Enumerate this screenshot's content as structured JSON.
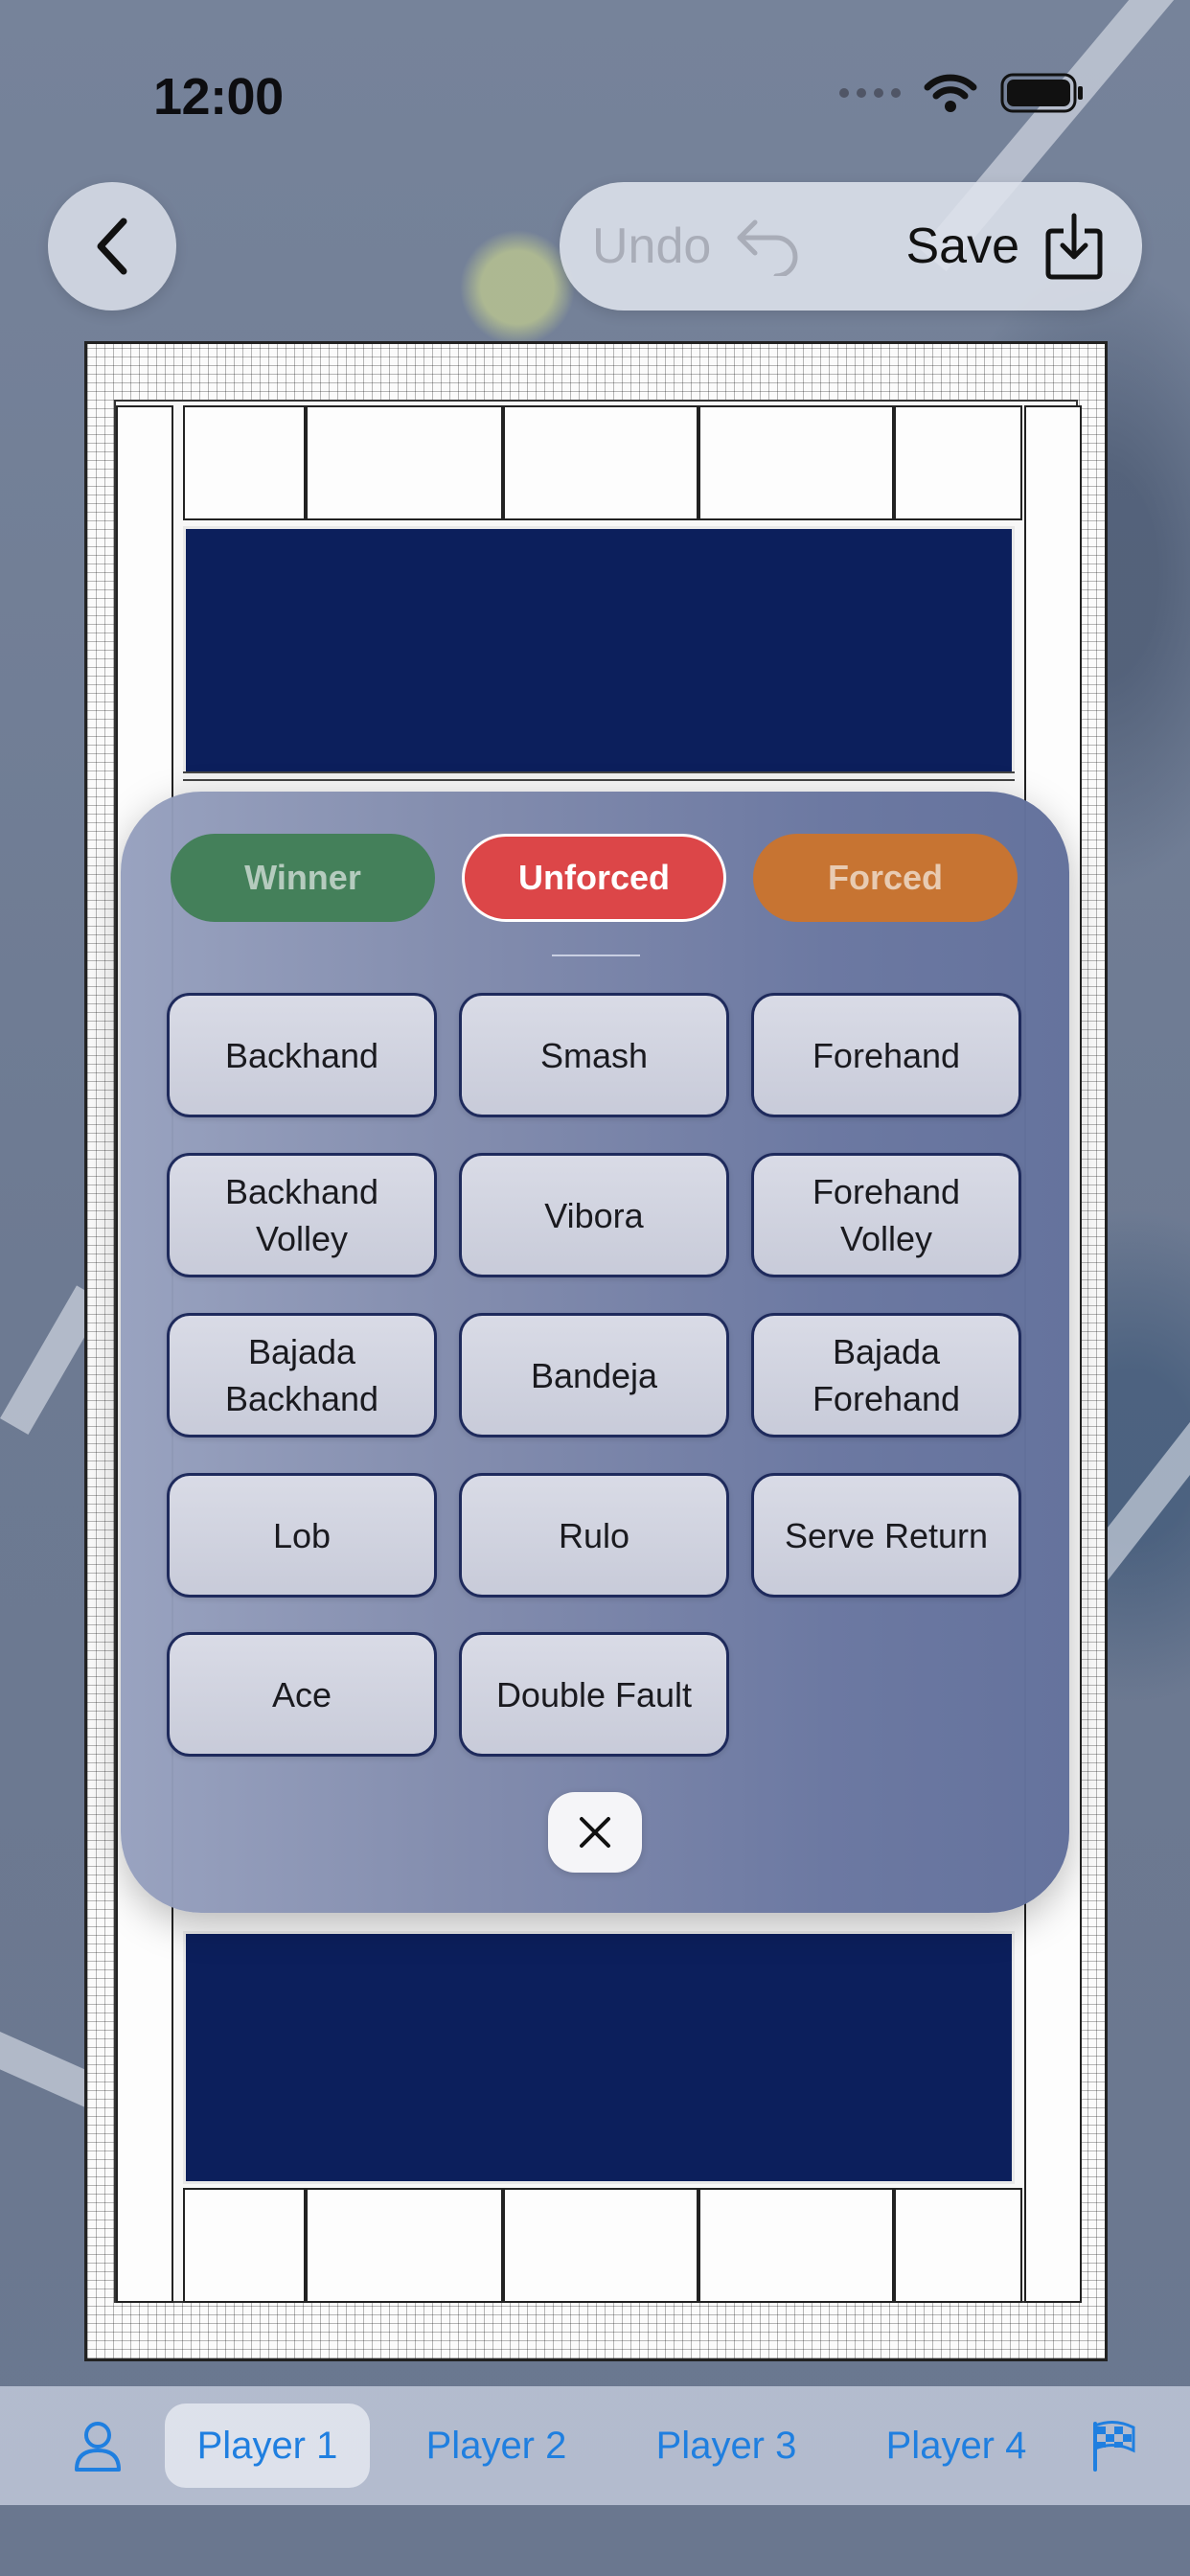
{
  "status_bar": {
    "time": "12:00"
  },
  "toolbar": {
    "undo_label": "Undo",
    "save_label": "Save"
  },
  "categories": [
    {
      "label": "Winner",
      "color": "#44805a",
      "selected": false
    },
    {
      "label": "Unforced",
      "color": "#dc4648",
      "selected": true
    },
    {
      "label": "Forced",
      "color": "#c77432",
      "selected": false
    }
  ],
  "shots": [
    "Backhand",
    "Smash",
    "Forehand",
    "Backhand\nVolley",
    "Vibora",
    "Forehand\nVolley",
    "Bajada\nBackhand",
    "Bandeja",
    "Bajada\nForehand",
    "Lob",
    "Rulo",
    "Serve Return",
    "Ace",
    "Double Fault"
  ],
  "tabs": [
    {
      "label": "Player 1",
      "active": true
    },
    {
      "label": "Player 2",
      "active": false
    },
    {
      "label": "Player 3",
      "active": false
    },
    {
      "label": "Player 4",
      "active": false
    }
  ],
  "icons": {
    "back": "chevron-left-icon",
    "undo": "undo-arrow-icon",
    "save": "download-tray-icon",
    "close": "close-icon",
    "person": "person-icon",
    "finish": "checkered-flag-icon"
  },
  "colors": {
    "accent": "#1f7fe0",
    "court_floor": "#0c1f5c",
    "button_border": "#1e2a5c"
  }
}
